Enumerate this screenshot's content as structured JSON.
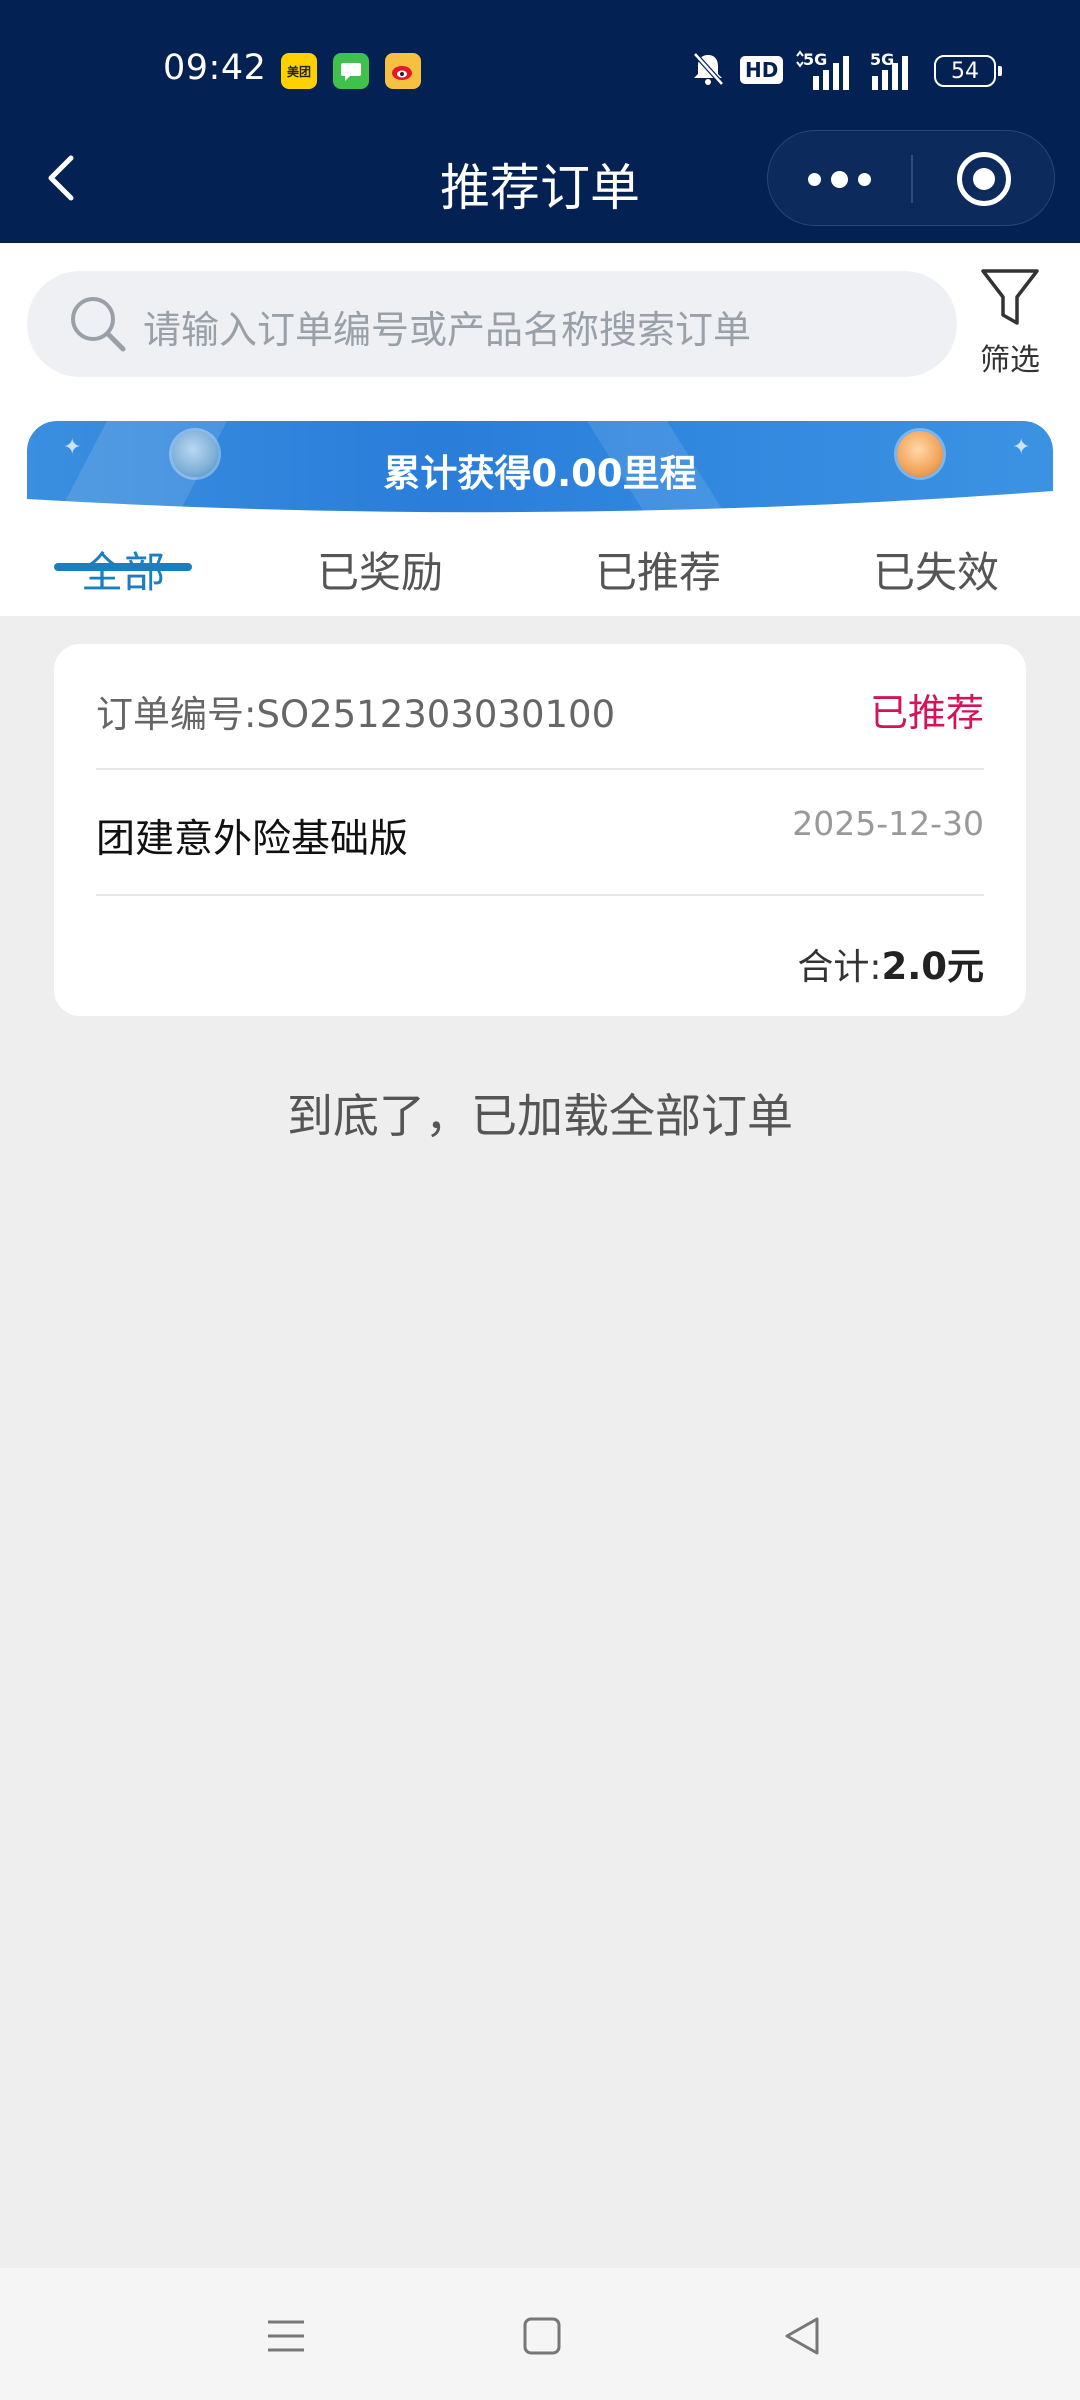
{
  "status_bar": {
    "time": "09:42",
    "apps": [
      {
        "name": "meituan-icon",
        "label": "美团"
      },
      {
        "name": "message-icon"
      },
      {
        "name": "weibo-icon"
      }
    ],
    "network_1": "5G",
    "network_2": "5G",
    "hd_label": "HD",
    "battery": "54"
  },
  "nav": {
    "title": "推荐订单"
  },
  "search": {
    "placeholder": "请输入订单编号或产品名称搜索订单",
    "filter_label": "筛选"
  },
  "banner": {
    "text": "累计获得0.00里程"
  },
  "tabs": [
    {
      "label": "全部",
      "active": true
    },
    {
      "label": "已奖励",
      "active": false
    },
    {
      "label": "已推荐",
      "active": false
    },
    {
      "label": "已失效",
      "active": false
    }
  ],
  "orders": [
    {
      "order_no_label": "订单编号:",
      "order_no": "SO2512303030100",
      "status": "已推荐",
      "product": "团建意外险基础版",
      "date": "2025-12-30",
      "total_label": "合计:",
      "total_value": "2.0元"
    }
  ],
  "end_text": "到底了，已加载全部订单",
  "colors": {
    "header_bg": "#042154",
    "accent": "#1a7fc1",
    "status_color": "#d4145a",
    "page_bg": "#eeeeee"
  }
}
